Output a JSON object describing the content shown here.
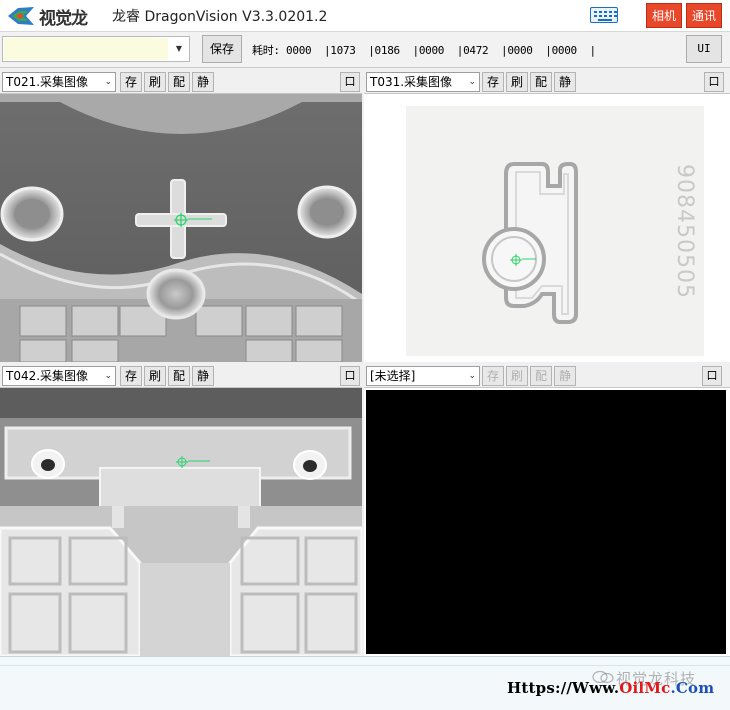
{
  "titlebar": {
    "logo_text": "视觉龙",
    "app_title": "龙睿 DragonVision V3.3.0201.2",
    "camera_button": "相机",
    "comm_button": "通讯",
    "keyboard_icon": "keyboard-icon"
  },
  "toolbar": {
    "combo_value": "",
    "save_label": "保存",
    "timing_text": "耗时: 0000  |1073  |0186  |0000  |0472  |0000  |0000  |",
    "ui_label": "UI"
  },
  "panels": [
    {
      "id": "t021",
      "select_value": "T021.采集图像",
      "buttons": [
        "存",
        "刷",
        "配",
        "静"
      ],
      "max_label": "口",
      "view": "gray-part-cross-marker"
    },
    {
      "id": "t031",
      "select_value": "T031.采集图像",
      "buttons": [
        "存",
        "刷",
        "配",
        "静"
      ],
      "max_label": "口",
      "view": "white-part-with-serial",
      "serial_text": "908450505"
    },
    {
      "id": "t042",
      "select_value": "T042.采集图像",
      "buttons": [
        "存",
        "刷",
        "配",
        "静"
      ],
      "max_label": "口",
      "view": "bracket-part"
    },
    {
      "id": "empty",
      "select_value": "[未选择]",
      "buttons": [
        "存",
        "刷",
        "配",
        "静"
      ],
      "buttons_disabled": true,
      "max_label": "口",
      "view": "black-empty"
    }
  ],
  "status": {
    "watermark": "视觉龙科技",
    "url_prefix": "Https://Www.",
    "url_accent": "OilMc",
    "url_suffix": ".Com"
  },
  "colors": {
    "accent_red": "#e8472a",
    "marker_green": "#2bd36a"
  }
}
